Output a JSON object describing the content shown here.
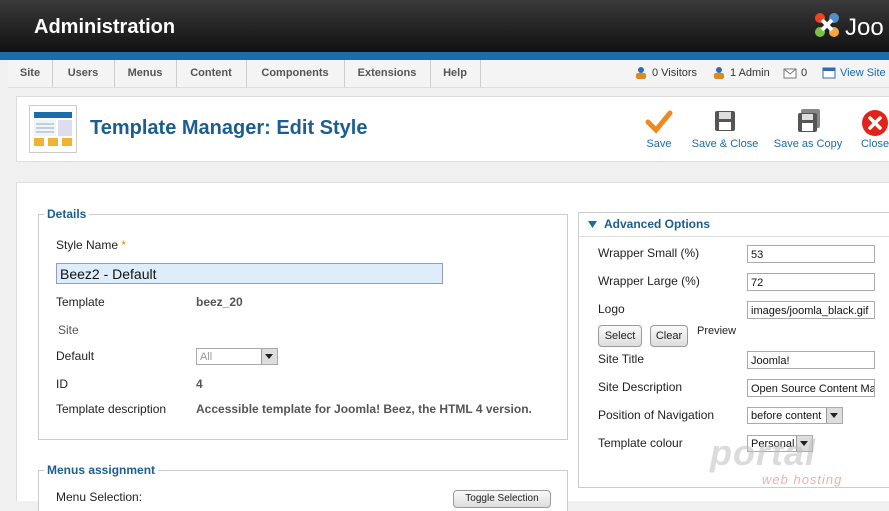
{
  "header": {
    "title": "Administration",
    "logo_text": "Joo"
  },
  "menu": {
    "items": [
      "Site",
      "Users",
      "Menus",
      "Content",
      "Components",
      "Extensions",
      "Help"
    ]
  },
  "status": {
    "visitors": "0 Visitors",
    "admins": "1 Admin",
    "messages": "0",
    "view_site": "View Site"
  },
  "page": {
    "title": "Template Manager: Edit Style"
  },
  "toolbar": {
    "save": "Save",
    "save_close": "Save & Close",
    "save_copy": "Save as Copy",
    "close": "Close"
  },
  "details": {
    "legend": "Details",
    "style_name_label": "Style Name",
    "required_mark": "*",
    "style_name_value": "Beez2 - Default",
    "template_label": "Template",
    "template_value": "beez_20",
    "site_label": "Site",
    "default_label": "Default",
    "default_value": "All",
    "id_label": "ID",
    "id_value": "4",
    "description_label": "Template description",
    "description_value": "Accessible template for Joomla! Beez, the HTML 4 version."
  },
  "menus_assignment": {
    "legend": "Menus assignment",
    "menu_selection_label": "Menu Selection:",
    "toggle_button": "Toggle Selection"
  },
  "advanced": {
    "title": "Advanced Options",
    "wrapper_small_label": "Wrapper Small (%)",
    "wrapper_small_value": "53",
    "wrapper_large_label": "Wrapper Large (%)",
    "wrapper_large_value": "72",
    "logo_label": "Logo",
    "logo_value": "images/joomla_black.gif",
    "select_button": "Select",
    "clear_button": "Clear",
    "preview_label": "Preview",
    "site_title_label": "Site Title",
    "site_title_value": "Joomla!",
    "site_description_label": "Site Description",
    "site_description_value": "Open Source Content Management",
    "nav_position_label": "Position of Navigation",
    "nav_position_value": "before content",
    "colour_label": "Template colour",
    "colour_value": "Personal"
  },
  "watermark": {
    "brand": "portal",
    "sub": "web hosting"
  },
  "colors": {
    "accent": "#1b6ca8",
    "title": "#1b5e8f",
    "highlight": "#ddeefa"
  }
}
